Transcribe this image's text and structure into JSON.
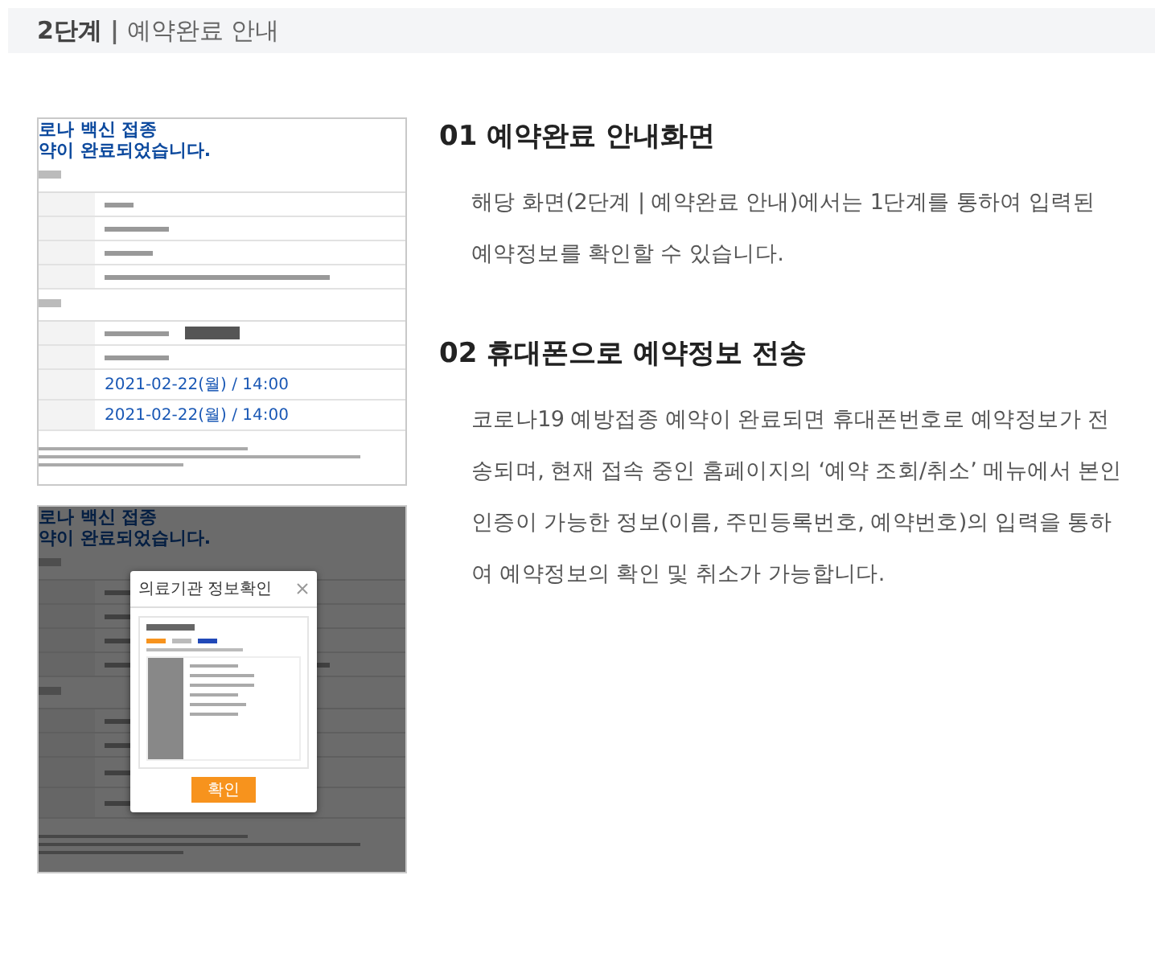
{
  "header": {
    "step": "2단계",
    "separator": "|",
    "title": "예약완료 안내"
  },
  "screenshots": [
    {
      "kind": "page",
      "headline": [
        "로나 백신 접종",
        "약이 완료되었습니다."
      ],
      "dates": [
        "2021-02-22(월) / 14:00",
        "2021-02-22(월) / 14:00"
      ]
    },
    {
      "kind": "popup",
      "headline": [
        "로나 백신 접종",
        "약이 완료되었습니다."
      ],
      "popup_title": "의료기관 정보확인",
      "popup_button": "확인"
    }
  ],
  "sections": [
    {
      "number": "01",
      "title": "예약완료 안내화면",
      "body": "해당 화면(2단계 | 예약완료 안내)에서는 1단계를 통하여 입력된 예약정보를 확인할 수 있습니다."
    },
    {
      "number": "02",
      "title": "휴대폰으로 예약정보 전송",
      "body": "코로나19 예방접종 예약이 완료되면 휴대폰번호로 예약정보가 전송되며, 현재 접속 중인 홈페이지의 ‘예약 조회/취소’ 메뉴에서 본인인증이 가능한 정보(이름, 주민등록번호, 예약번호)의 입력을 통하여 예약정보의 확인 및 취소가 가능합니다."
    }
  ]
}
